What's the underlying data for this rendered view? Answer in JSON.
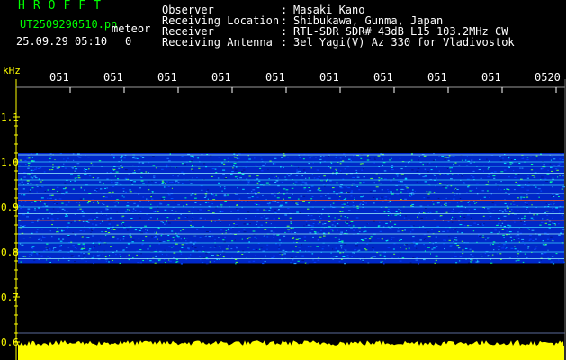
{
  "header": {
    "title": "HROFFT",
    "file_name": "UT2509290510.pn",
    "detector": "meteor",
    "date_time": "25.09.29 05:10",
    "count": "0",
    "fields": [
      {
        "label": "Observer",
        "value": "Masaki Kano"
      },
      {
        "label": "Receiving Location",
        "value": "Shibukawa, Gunma, Japan"
      },
      {
        "label": "Receiver",
        "value": "RTL-SDR SDR# 43dB L15 103.2MHz CW"
      },
      {
        "label": "Receiving Antenna",
        "value": "3el Yagi(V) Az 330 for Vladivostok"
      }
    ]
  },
  "axes": {
    "y_unit": "kHz",
    "y_ticks": [
      "1.1",
      "1.0",
      "0.9",
      "0.8",
      "0.7",
      "0.6"
    ],
    "x_ticks": [
      "051",
      "051",
      "051",
      "051",
      "051",
      "051",
      "051",
      "051",
      "051",
      "0520"
    ]
  },
  "colors": {
    "header_green": "#00ff00",
    "header_white": "#ffffff",
    "axis_yellow": "#ffff00",
    "tick_white": "#ffffff",
    "band_blue": "#0028c8",
    "noise_yellow": "#ffff00",
    "trace_red": "#ff2a00"
  },
  "spectrogram": {
    "band_range_khz": [
      0.775,
      1.02
    ],
    "noise_floor_khz": 0.6,
    "red_trace_khz": [
      0.915,
      0.87
    ]
  }
}
